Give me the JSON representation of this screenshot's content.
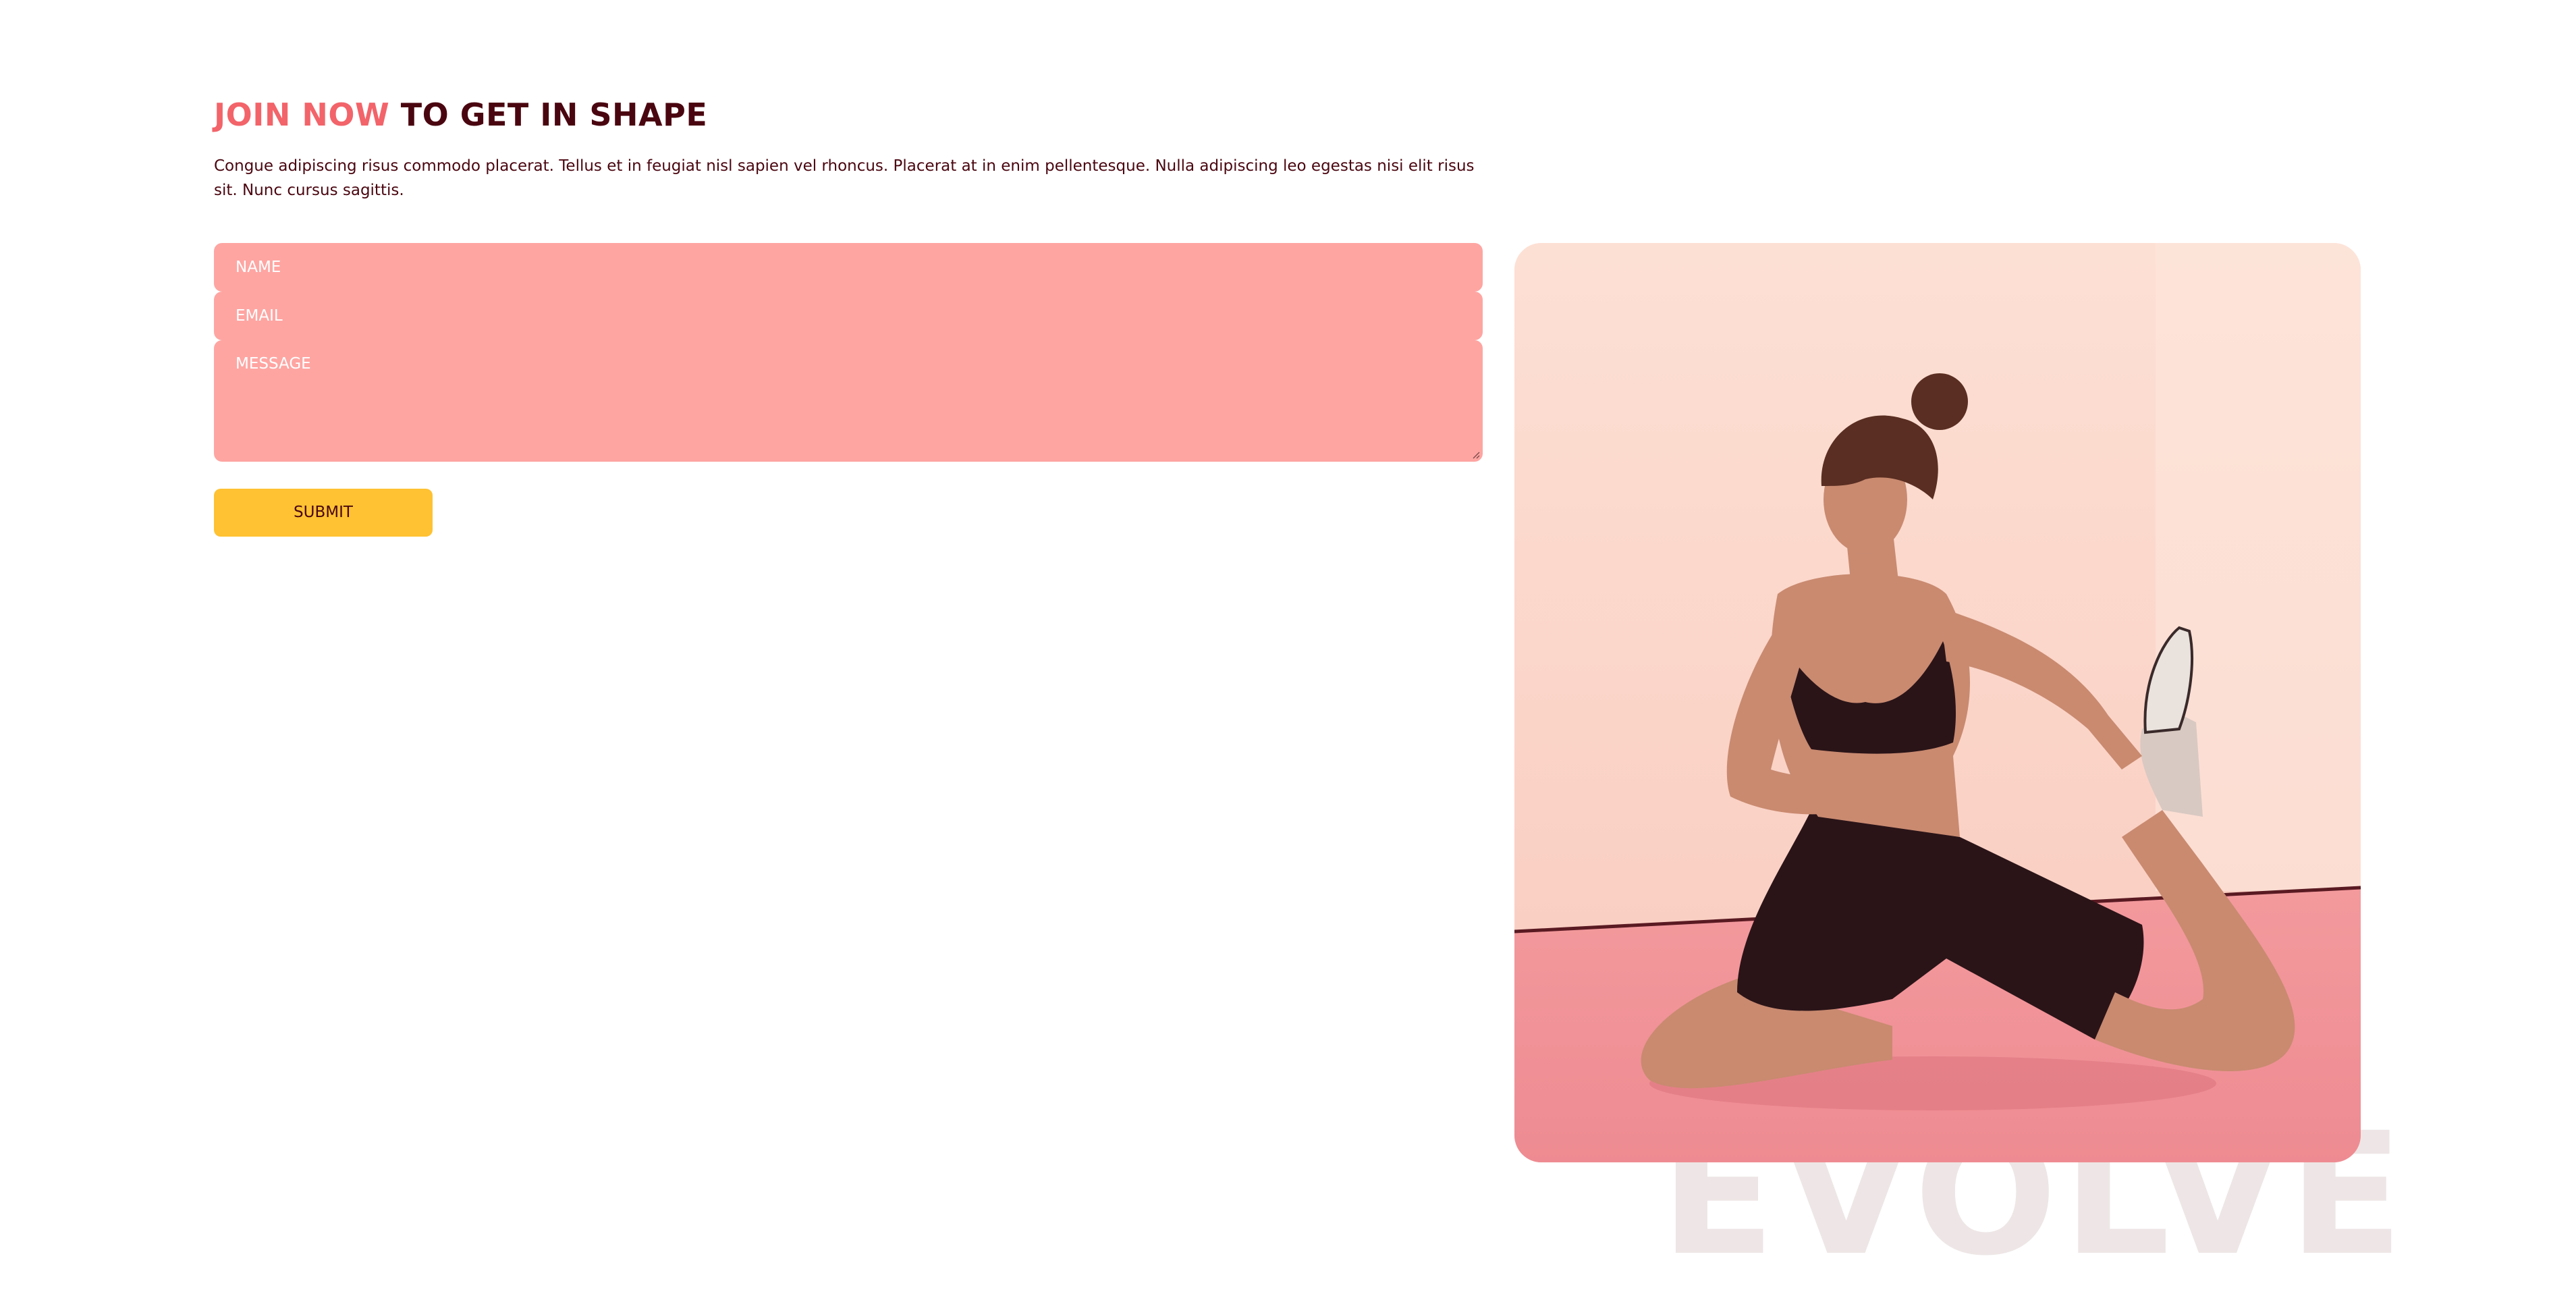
{
  "heading": {
    "accent": "JOIN NOW",
    "rest": "TO GET IN SHAPE"
  },
  "description": "Congue adipiscing risus commodo placerat. Tellus et in feugiat nisl sapien vel rhoncus. Placerat at in enim pellentesque. Nulla adipiscing leo egestas nisi elit risus sit. Nunc cursus sagittis.",
  "form": {
    "name_placeholder": "NAME",
    "email_placeholder": "EMAIL",
    "message_placeholder": "MESSAGE",
    "submit_label": "SUBMIT"
  },
  "watermark": "EVOLVE",
  "colors": {
    "accent": "#f2646a",
    "dark": "#4a0610",
    "field_bg": "#fea5a2",
    "button_bg": "#fec232"
  }
}
